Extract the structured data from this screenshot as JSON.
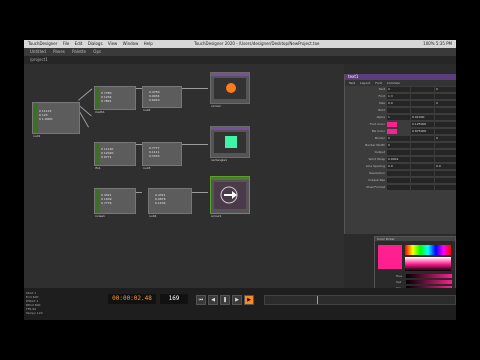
{
  "app": {
    "name": "TouchDesigner",
    "menu": [
      "TouchDesigner",
      "File",
      "Edit",
      "Dialogs",
      "View",
      "Window",
      "Help"
    ],
    "window_title": "TouchDesigner 2020 - /Users/designer/Desktop/NewProject.toe",
    "status_right": "100% 5:35 PM"
  },
  "toolbar": {
    "items": [
      "Untitled",
      "Panes",
      "Palette",
      "Ops"
    ]
  },
  "pathbar": {
    "path": "/project1"
  },
  "nodes": {
    "root": {
      "label": "null1",
      "lines": [
        "0 11123",
        "0 123",
        "0 1.0000"
      ]
    },
    "mid1": {
      "label": "math1",
      "lines": [
        "0 7780",
        "0 1234",
        "0 7891"
      ]
    },
    "mid2": {
      "label": "lfo1",
      "lines": [
        "0 11140",
        "0 12020",
        "0 9771"
      ]
    },
    "mid3": {
      "label": "noise1",
      "lines": [
        "0 4321",
        "0 1009",
        "0 7776"
      ]
    },
    "r1": {
      "label": "null2",
      "lines": [
        "0.4750",
        "0.0034",
        "0.6910"
      ]
    },
    "r2": {
      "label": "null3",
      "lines": [
        "0.7777",
        "0.1111",
        "0.3333"
      ]
    },
    "r3": {
      "label": "null4",
      "lines": [
        "0.4321",
        "0.9876",
        "0.1234"
      ]
    },
    "top1": {
      "label": "circle1"
    },
    "top2": {
      "label": "rectangle1"
    },
    "top3": {
      "label": "arrow1"
    }
  },
  "param": {
    "title": "text1",
    "tabs": [
      "Text",
      "Layout",
      "Font",
      "Common"
    ],
    "rows": [
      {
        "label": "Text",
        "v1": "0",
        "v2": "",
        "v3": "0"
      },
      {
        "label": "Font",
        "v1": "1.3",
        "v2": "",
        "v3": ""
      },
      {
        "label": "Size",
        "v1": "0.0",
        "v2": "",
        "v3": "0"
      },
      {
        "label": "Bold",
        "v1": "",
        "v2": "",
        "v3": ""
      },
      {
        "label": "Alpha",
        "v1": "1",
        "v2": "0.01000",
        "v3": ""
      },
      {
        "label": "Font Color",
        "v1": "",
        "v2": "0.125000",
        "v3": ""
      },
      {
        "label": "BG Color",
        "v1": "",
        "v2": "0.875000",
        "v3": ""
      },
      {
        "label": "Border",
        "v1": "0",
        "v2": "",
        "v3": "0"
      },
      {
        "label": "Border Width",
        "v1": "0",
        "v2": "",
        "v3": ""
      },
      {
        "label": "Output",
        "v1": "",
        "v2": "",
        "v3": ""
      },
      {
        "label": "Word Wrap",
        "v1": "0.0001",
        "v2": "",
        "v3": ""
      },
      {
        "label": "Line Spacing",
        "v1": "0.0",
        "v2": "",
        "v3": "0.0"
      },
      {
        "label": "Resolution",
        "v1": "",
        "v2": "",
        "v3": ""
      },
      {
        "label": "Output Res",
        "v1": "",
        "v2": "",
        "v3": ""
      },
      {
        "label": "Pixel Format",
        "v1": "",
        "v2": "",
        "v3": ""
      }
    ]
  },
  "picker": {
    "title": "Color Picker",
    "labels": [
      "Hue",
      "Sat",
      "Val",
      "Red",
      "Grn",
      "Blu",
      "A"
    ]
  },
  "colors": {
    "accent": "#ff1f8f",
    "circle": "#ff7a1a",
    "rect": "#3ff5a5",
    "node_active": "#5aa02c"
  },
  "timeline": {
    "stats": [
      "Start 1",
      "End 600",
      "RStart 1",
      "REnd 600",
      "FPS 60",
      "Tempo 120"
    ],
    "timecode": "00:00:02.48",
    "frame": "169"
  }
}
